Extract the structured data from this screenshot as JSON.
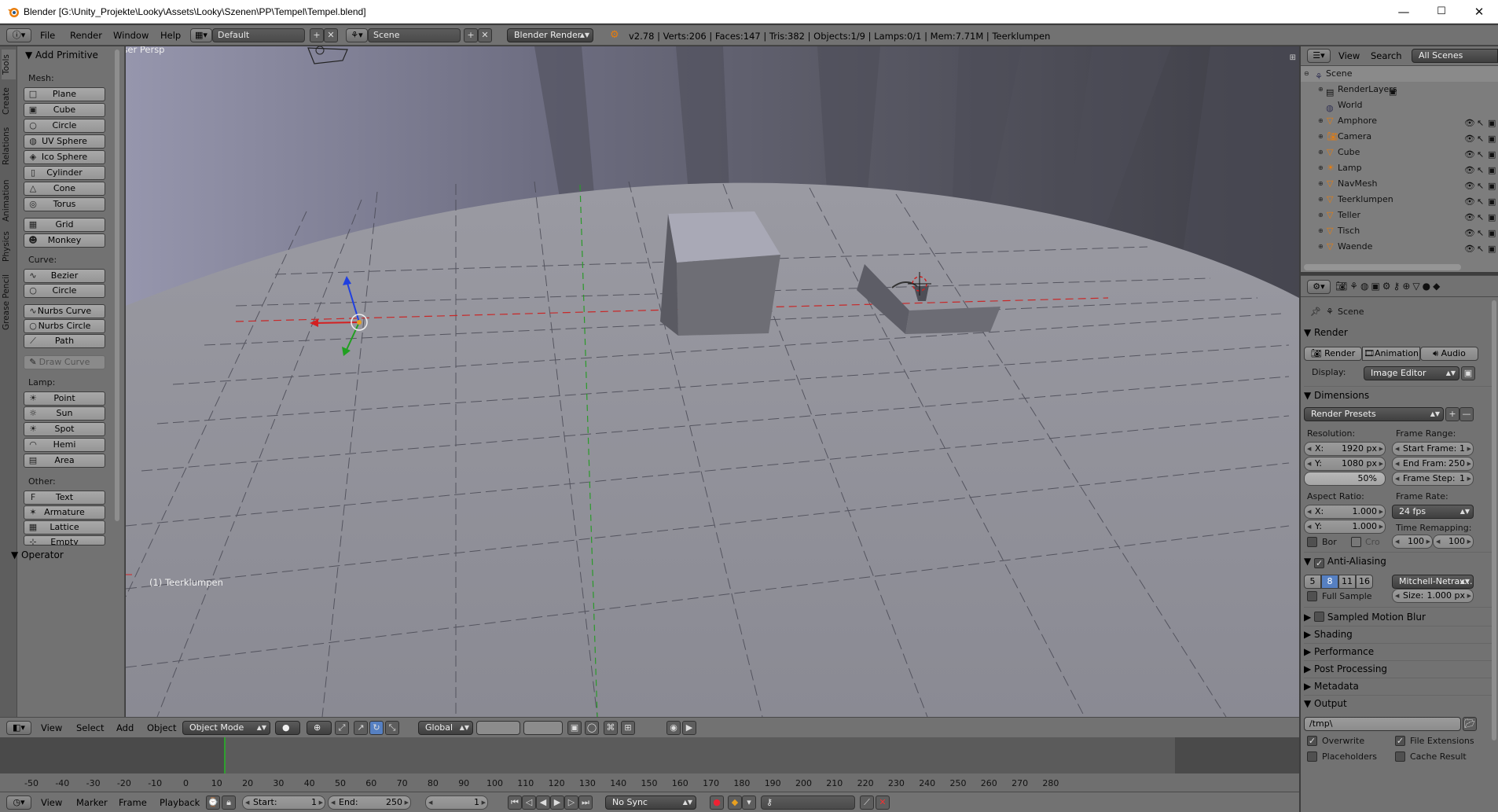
{
  "window": {
    "title": "Blender [G:\\Unity_Projekte\\Looky\\Assets\\Looky\\Szenen\\PP\\Tempel\\Tempel.blend]",
    "minimize": "—",
    "maximize": "☐",
    "close": "✕"
  },
  "infobar": {
    "menus": [
      "File",
      "Render",
      "Window",
      "Help"
    ],
    "layout": "Default",
    "scene": "Scene",
    "engine": "Blender Render",
    "stats": "v2.78 | Verts:206 | Faces:147 | Tris:382 | Objects:1/9 | Lamps:0/1 | Mem:7.71M | Teerklumpen"
  },
  "toolshelf": {
    "tabs": [
      "Tools",
      "Create",
      "Relations",
      "Animation",
      "Physics",
      "Grease Pencil"
    ],
    "panel_title": "Add Primitive",
    "mesh_label": "Mesh:",
    "mesh": [
      "Plane",
      "Cube",
      "Circle",
      "UV Sphere",
      "Ico Sphere",
      "Cylinder",
      "Cone",
      "Torus"
    ],
    "grid": "Grid",
    "monkey": "Monkey",
    "curve_label": "Curve:",
    "curve": [
      "Bezier",
      "Circle"
    ],
    "nurbs": [
      "Nurbs Curve",
      "Nurbs Circle",
      "Path"
    ],
    "draw_curve": "Draw Curve",
    "lamp_label": "Lamp:",
    "lamp": [
      "Point",
      "Sun",
      "Spot",
      "Hemi",
      "Area"
    ],
    "other_label": "Other:",
    "other": [
      "Text",
      "Armature",
      "Lattice",
      "Empty"
    ],
    "operator": "Operator"
  },
  "viewport": {
    "view_name": "User Persp",
    "active_object": "(1) Teerklumpen",
    "colors": {
      "sky": "#8f8fa6",
      "floor": "#8c8c96",
      "accent_x": "#d42020",
      "accent_y": "#20a020",
      "accent_z": "#2040e0"
    }
  },
  "vp_header": {
    "menus": [
      "View",
      "Select",
      "Add",
      "Object"
    ],
    "mode": "Object Mode",
    "orientation": "Global"
  },
  "timeline": {
    "ruler": [
      "-50",
      "-40",
      "-30",
      "-20",
      "-10",
      "0",
      "10",
      "20",
      "30",
      "40",
      "50",
      "60",
      "70",
      "80",
      "90",
      "100",
      "110",
      "120",
      "130",
      "140",
      "150",
      "160",
      "170",
      "180",
      "190",
      "200",
      "210",
      "220",
      "230",
      "240",
      "250",
      "260",
      "270",
      "280"
    ],
    "menus": [
      "View",
      "Marker",
      "Frame",
      "Playback"
    ],
    "start_label": "Start:",
    "start": "1",
    "end_label": "End:",
    "end": "250",
    "current": "1",
    "sync": "No Sync"
  },
  "outliner": {
    "menus": [
      "View",
      "Search"
    ],
    "filter": "All Scenes",
    "scene": "Scene",
    "items": [
      "RenderLayers",
      "World",
      "Amphore",
      "Camera",
      "Cube",
      "Lamp",
      "NavMesh",
      "Teerklumpen",
      "Teller",
      "Tisch",
      "Waende"
    ]
  },
  "properties": {
    "context": "Scene",
    "render_panel": "Render",
    "render_btn": "Render",
    "animation_btn": "Animation",
    "audio_btn": "Audio",
    "display_label": "Display:",
    "display": "Image Editor",
    "dimensions": "Dimensions",
    "presets": "Render Presets",
    "resolution_label": "Resolution:",
    "res_x_label": "X:",
    "res_x": "1920 px",
    "res_y_label": "Y:",
    "res_y": "1080 px",
    "res_pct": "50%",
    "frame_range_label": "Frame Range:",
    "start_frame_label": "Start Frame:",
    "start_frame": "1",
    "end_frame_label": "End Fram:",
    "end_frame": "250",
    "frame_step_label": "Frame Step:",
    "frame_step": "1",
    "aspect_label": "Aspect Ratio:",
    "asp_x_label": "X:",
    "asp_x": "1.000",
    "asp_y_label": "Y:",
    "asp_y": "1.000",
    "frame_rate_label": "Frame Rate:",
    "frame_rate": "24 fps",
    "time_remap_label": "Time Remapping:",
    "remap_old": "100",
    "remap_new": "100",
    "bor": "Bor",
    "cro": "Cro",
    "aa": "Anti-Aliasing",
    "aa_samples": [
      "5",
      "8",
      "11",
      "16"
    ],
    "aa_filter": "Mitchell-Netrav...",
    "full_sample": "Full Sample",
    "size_label": "Size:",
    "size": "1.000 px",
    "sampled_motion_blur": "Sampled Motion Blur",
    "shading": "Shading",
    "performance": "Performance",
    "post_processing": "Post Processing",
    "metadata": "Metadata",
    "output": "Output",
    "output_path": "/tmp\\",
    "overwrite": "Overwrite",
    "file_extensions": "File Extensions",
    "placeholders": "Placeholders",
    "cache_result": "Cache Result"
  }
}
